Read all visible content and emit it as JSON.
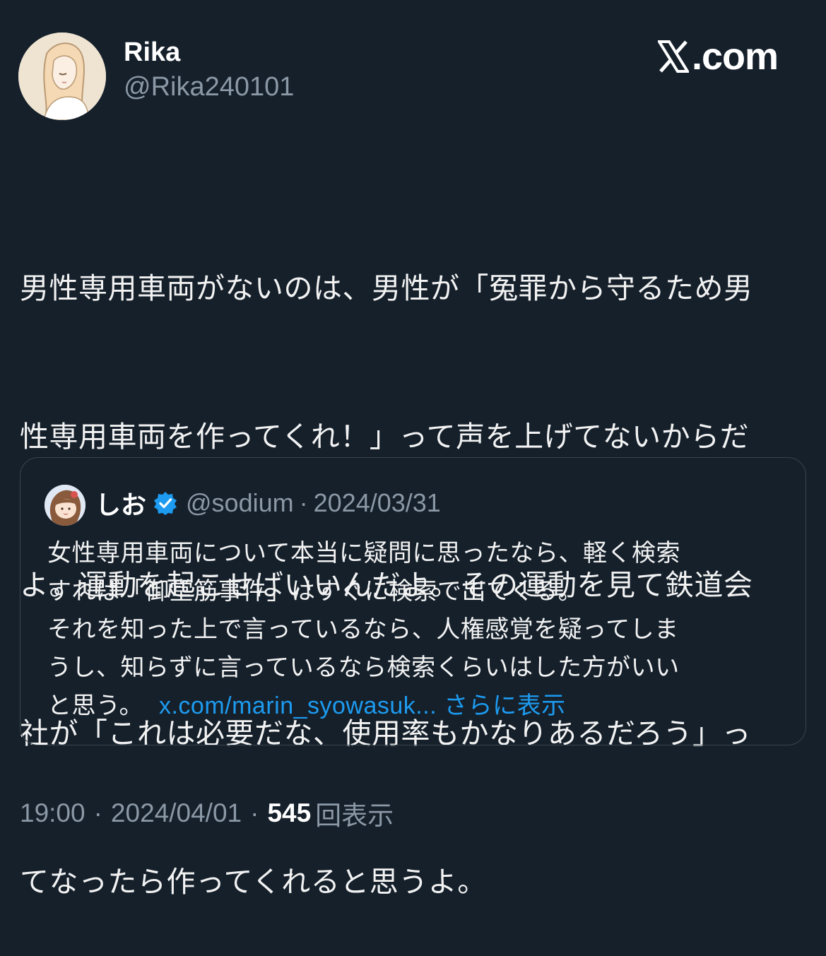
{
  "author": {
    "display_name": "Rika",
    "handle": "@Rika240101",
    "avatar_icon": "illustrated-avatar-woman-long-hair"
  },
  "brand": {
    "label": ".com",
    "icon": "x-logo-icon"
  },
  "tweet": {
    "lines": [
      "男性専用車両がないのは、男性が「冤罪から守るため男",
      "性専用車両を作ってくれ！」って声を上げてないからだ",
      "よ。運動を起こせばいいんだよ。その運動を見て鉄道会",
      "社が「これは必要だな、使用率もかなりあるだろう」っ",
      "てなったら作ってくれると思うよ。"
    ]
  },
  "quote": {
    "display_name": "しお",
    "verified": true,
    "handle": "@sodium",
    "separator": "·",
    "date": "2024/03/31",
    "avatar_icon": "illustrated-avatar-girl",
    "lines": [
      "女性専用車両について本当に疑問に思ったなら、軽く検索",
      "すれば「御堂筋事件」はすぐに検索で出てくる。",
      "それを知った上で言っているなら、人権感覚を疑ってしま",
      "うし、知らずに言っているなら検索くらいはした方がいい",
      "と思う。"
    ],
    "link": "x.com/marin_syowasuk...",
    "show_more": "さらに表示",
    "link_color": "#1d9bf0"
  },
  "meta": {
    "time": "19:00",
    "separator": "·",
    "date": "2024/04/01",
    "views_count": "545",
    "views_label": "回表示"
  },
  "colors": {
    "background": "#15202b",
    "secondary_text": "#8b98a5",
    "border": "#38444d",
    "accent": "#1d9bf0"
  }
}
